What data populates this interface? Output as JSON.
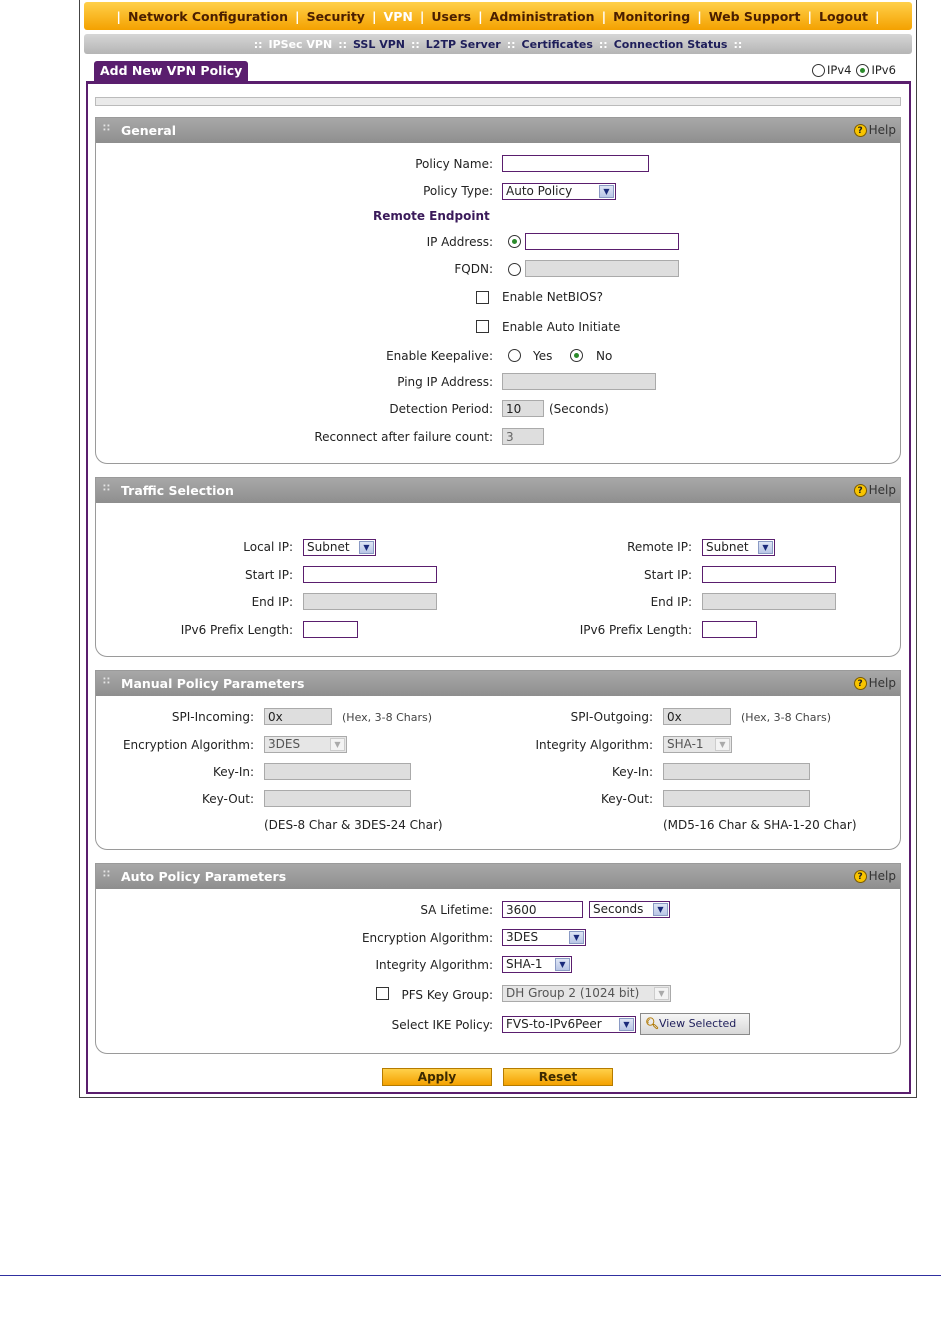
{
  "top_nav": {
    "items": [
      {
        "label": "Network Configuration",
        "active": false
      },
      {
        "label": "Security",
        "active": false
      },
      {
        "label": "VPN",
        "active": true
      },
      {
        "label": "Users",
        "active": false
      },
      {
        "label": "Administration",
        "active": false
      },
      {
        "label": "Monitoring",
        "active": false
      },
      {
        "label": "Web Support",
        "active": false
      },
      {
        "label": "Logout",
        "active": false
      }
    ]
  },
  "sub_nav": {
    "items": [
      {
        "label": "IPSec VPN",
        "active": true
      },
      {
        "label": "SSL VPN",
        "active": false
      },
      {
        "label": "L2TP Server",
        "active": false
      },
      {
        "label": "Certificates",
        "active": false
      },
      {
        "label": "Connection Status",
        "active": false
      }
    ]
  },
  "tab": {
    "label": "Add New VPN Policy"
  },
  "ip_version": {
    "ipv4": "IPv4",
    "ipv6": "IPv6",
    "selected": "ipv6"
  },
  "help_label": "Help",
  "general": {
    "title": "General",
    "policy_name_label": "Policy Name:",
    "policy_name_value": "",
    "policy_type_label": "Policy Type:",
    "policy_type_value": "Auto Policy",
    "remote_endpoint_label": "Remote Endpoint",
    "ip_address_label": "IP Address:",
    "ip_address_value": "",
    "fqdn_label": "FQDN:",
    "fqdn_value": "",
    "netbios_label": "Enable NetBIOS?",
    "auto_initiate_label": "Enable Auto Initiate",
    "keepalive_label": "Enable Keepalive:",
    "keepalive_yes": "Yes",
    "keepalive_no": "No",
    "keepalive_selected": "no",
    "ping_ip_label": "Ping IP Address:",
    "ping_ip_value": "",
    "detection_label": "Detection Period:",
    "detection_value": "10",
    "detection_unit": "(Seconds)",
    "reconnect_label": "Reconnect after failure count:",
    "reconnect_value": "3"
  },
  "traffic": {
    "title": "Traffic Selection",
    "local_ip_label": "Local IP:",
    "local_ip_type": "Subnet",
    "local_start_label": "Start IP:",
    "local_start_value": "",
    "local_end_label": "End IP:",
    "local_end_value": "",
    "local_prefix_label": "IPv6 Prefix Length:",
    "local_prefix_value": "",
    "remote_ip_label": "Remote IP:",
    "remote_ip_type": "Subnet",
    "remote_start_label": "Start IP:",
    "remote_start_value": "",
    "remote_end_label": "End IP:",
    "remote_end_value": "",
    "remote_prefix_label": "IPv6 Prefix Length:",
    "remote_prefix_value": ""
  },
  "manual": {
    "title": "Manual Policy Parameters",
    "spi_in_label": "SPI-Incoming:",
    "spi_in_value": "0x",
    "spi_in_hint": "(Hex, 3-8 Chars)",
    "enc_label": "Encryption Algorithm:",
    "enc_value": "3DES",
    "key_in_label": "Key-In:",
    "key_out_label": "Key-Out:",
    "enc_hint": "(DES-8 Char & 3DES-24 Char)",
    "spi_out_label": "SPI-Outgoing:",
    "spi_out_value": "0x",
    "spi_out_hint": "(Hex, 3-8 Chars)",
    "int_label": "Integrity Algorithm:",
    "int_value": "SHA-1",
    "key_in2_label": "Key-In:",
    "key_out2_label": "Key-Out:",
    "int_hint": "(MD5-16 Char & SHA-1-20 Char)"
  },
  "auto": {
    "title": "Auto Policy Parameters",
    "sa_label": "SA Lifetime:",
    "sa_value": "3600",
    "sa_unit": "Seconds",
    "enc_label": "Encryption Algorithm:",
    "enc_value": "3DES",
    "int_label": "Integrity Algorithm:",
    "int_value": "SHA-1",
    "pfs_label": "PFS Key Group:",
    "pfs_value": "DH Group 2 (1024 bit)",
    "ike_label": "Select IKE Policy:",
    "ike_value": "FVS-to-IPv6Peer",
    "view_selected": "View Selected"
  },
  "buttons": {
    "apply": "Apply",
    "reset": "Reset"
  }
}
